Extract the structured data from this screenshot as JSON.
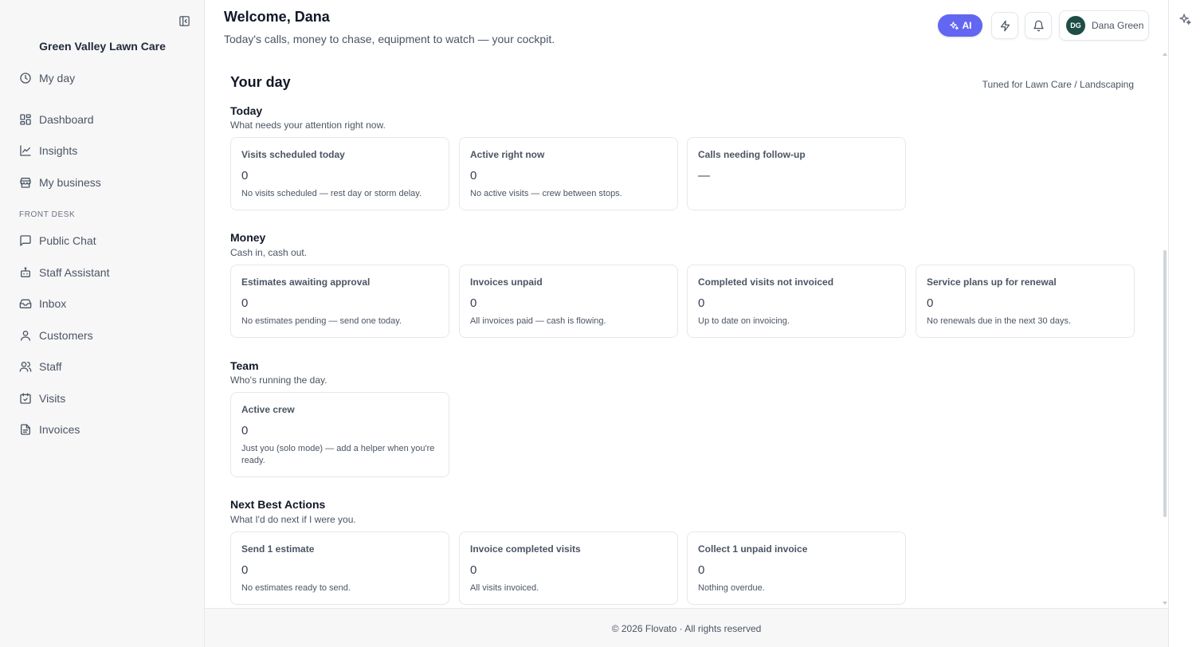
{
  "sidebar": {
    "brand": "Green Valley Lawn Care",
    "section_label": "FRONT DESK",
    "items": [
      {
        "label": "My day"
      },
      {
        "label": "Dashboard"
      },
      {
        "label": "Insights"
      },
      {
        "label": "My business"
      },
      {
        "label": "Public Chat"
      },
      {
        "label": "Staff Assistant"
      },
      {
        "label": "Inbox"
      },
      {
        "label": "Customers"
      },
      {
        "label": "Staff"
      },
      {
        "label": "Visits"
      },
      {
        "label": "Invoices"
      }
    ]
  },
  "header": {
    "title": "Welcome, Dana",
    "subtitle": "Today's calls, money to chase, equipment to watch — your cockpit.",
    "ai_label": "AI",
    "user": {
      "initials": "DG",
      "name": "Dana Green"
    }
  },
  "main": {
    "heading": "Your day",
    "tuned_for": "Tuned for Lawn Care / Landscaping",
    "groups": [
      {
        "title": "Today",
        "subtitle": "What needs your attention right now.",
        "cards": [
          {
            "title": "Visits scheduled today",
            "value": "0",
            "note": "No visits scheduled — rest day or storm delay."
          },
          {
            "title": "Active right now",
            "value": "0",
            "note": "No active visits — crew between stops."
          },
          {
            "title": "Calls needing follow-up",
            "value": "—",
            "note": ""
          }
        ]
      },
      {
        "title": "Money",
        "subtitle": "Cash in, cash out.",
        "cards": [
          {
            "title": "Estimates awaiting approval",
            "value": "0",
            "note": "No estimates pending — send one today."
          },
          {
            "title": "Invoices unpaid",
            "value": "0",
            "note": "All invoices paid — cash is flowing."
          },
          {
            "title": "Completed visits not invoiced",
            "value": "0",
            "note": "Up to date on invoicing."
          },
          {
            "title": "Service plans up for renewal",
            "value": "0",
            "note": "No renewals due in the next 30 days."
          }
        ]
      },
      {
        "title": "Team",
        "subtitle": "Who's running the day.",
        "cards": [
          {
            "title": "Active crew",
            "value": "0",
            "note": "Just you (solo mode) — add a helper when you're ready."
          }
        ]
      },
      {
        "title": "Next Best Actions",
        "subtitle": "What I'd do next if I were you.",
        "cards": [
          {
            "title": "Send 1 estimate",
            "value": "0",
            "note": "No estimates ready to send."
          },
          {
            "title": "Invoice completed visits",
            "value": "0",
            "note": "All visits invoiced."
          },
          {
            "title": "Collect 1 unpaid invoice",
            "value": "0",
            "note": "Nothing overdue."
          }
        ]
      }
    ]
  },
  "footer": {
    "text": "© 2026 Flovato · All rights reserved"
  },
  "colors": {
    "accent": "#6366f1",
    "avatar": "#1e4d45",
    "sidebar_bg": "#f7f7f8"
  }
}
